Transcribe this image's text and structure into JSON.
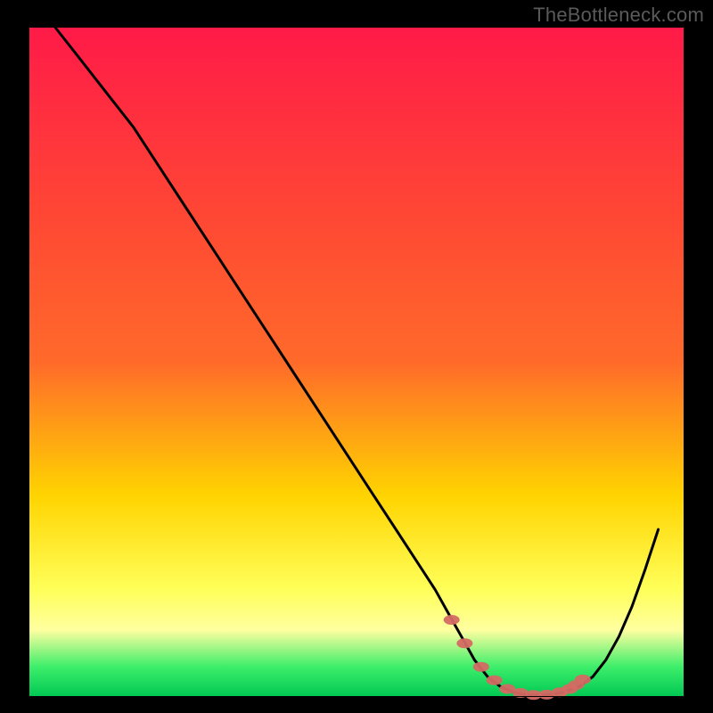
{
  "watermark": "TheBottleneck.com",
  "colors": {
    "gradient_top": "#ff1a48",
    "gradient_mid1": "#ff6a2a",
    "gradient_mid2": "#ffd400",
    "gradient_mid3": "#ffff5a",
    "gradient_bottom1": "#ffffa0",
    "gradient_bottom2": "#3dee6a",
    "gradient_bottom3": "#00c853",
    "curve": "#000000",
    "markers": "#d46a63",
    "border": "#000000"
  },
  "chart_data": {
    "type": "line",
    "title": "",
    "xlabel": "",
    "ylabel": "",
    "xlim": [
      0,
      100
    ],
    "ylim": [
      0,
      100
    ],
    "grid": false,
    "series": [
      {
        "name": "bottleneck-curve",
        "x": [
          4,
          8,
          12,
          16,
          20,
          24,
          28,
          32,
          36,
          40,
          44,
          48,
          52,
          56,
          60,
          62,
          64,
          66,
          68,
          70,
          72,
          74,
          76,
          78,
          80,
          82,
          84,
          86,
          88,
          90,
          92,
          94,
          96
        ],
        "values": [
          100,
          95,
          90,
          85,
          79,
          73,
          67,
          61,
          55,
          49,
          43,
          37,
          31,
          25,
          19,
          16,
          12.5,
          9,
          5.5,
          3,
          1.5,
          0.7,
          0.3,
          0.3,
          0.4,
          0.8,
          1.6,
          3,
          5.5,
          9,
          13.5,
          19,
          25
        ]
      }
    ],
    "markers": {
      "name": "bottleneck-zone",
      "x": [
        64.5,
        66.5,
        69,
        71,
        73,
        75,
        77,
        79,
        81,
        82.5,
        83.5,
        84.5
      ],
      "values": [
        11.5,
        8,
        4.5,
        2.5,
        1.2,
        0.6,
        0.3,
        0.35,
        0.7,
        1.2,
        1.8,
        2.6
      ]
    }
  }
}
